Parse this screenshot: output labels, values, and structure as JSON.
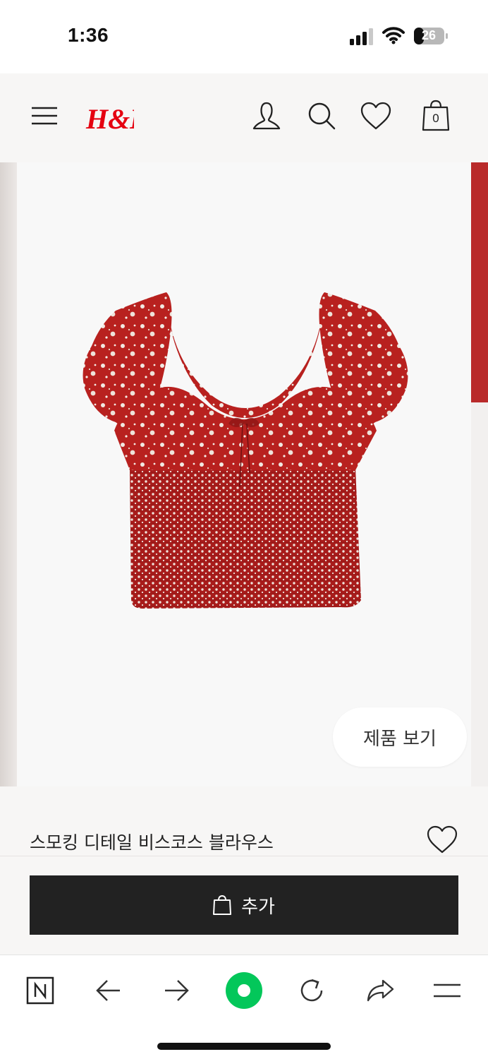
{
  "status_bar": {
    "time": "1:36",
    "battery_level": "26"
  },
  "header": {
    "logo_text": "H&M",
    "logo_color": "#e50010",
    "cart_count": "0",
    "icons": [
      "menu-icon",
      "hm-logo",
      "account-icon",
      "search-icon",
      "favorites-icon",
      "shopping-bag-icon"
    ]
  },
  "gallery": {
    "view_product_label": "제품 보기"
  },
  "product": {
    "name": "스모킹 디테일 비스코스 블라우스"
  },
  "cart": {
    "add_label": "추가",
    "button_color": "#222222"
  },
  "browser_bar": {
    "icons": [
      "naver-n-icon",
      "back-arrow-icon",
      "forward-arrow-icon",
      "green-home-icon",
      "reload-icon",
      "share-icon",
      "browser-menu-icon"
    ],
    "accent": "#03c75a"
  }
}
